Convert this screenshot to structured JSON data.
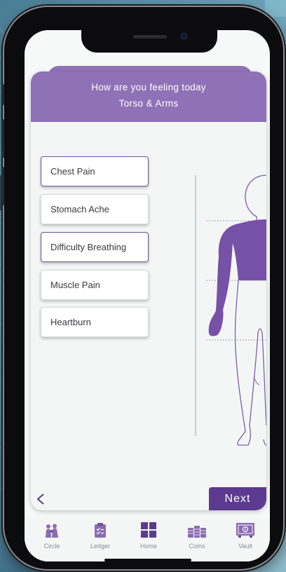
{
  "header": {
    "question": "How are you feeling today",
    "area": "Torso & Arms"
  },
  "symptoms": [
    {
      "label": "Chest Pain",
      "selected": true
    },
    {
      "label": "Stomach Ache",
      "selected": false
    },
    {
      "label": "Difficulty Breathing",
      "selected": true
    },
    {
      "label": "Muscle Pain",
      "selected": false
    },
    {
      "label": "Heartburn",
      "selected": false
    }
  ],
  "nav": {
    "back_icon": "chevron-left-icon",
    "next_label": "Next"
  },
  "tabbar": [
    {
      "label": "Circle",
      "icon": "family-icon"
    },
    {
      "label": "Ledger",
      "icon": "clipboard-checklist-icon"
    },
    {
      "label": "Home",
      "icon": "grid-icon"
    },
    {
      "label": "Coins",
      "icon": "coin-stacks-icon"
    },
    {
      "label": "Vault",
      "icon": "safe-icon"
    }
  ],
  "colors": {
    "header_purple": "#8e71b6",
    "accent_purple": "#5c3a8f",
    "body_highlight": "#7750a8"
  }
}
